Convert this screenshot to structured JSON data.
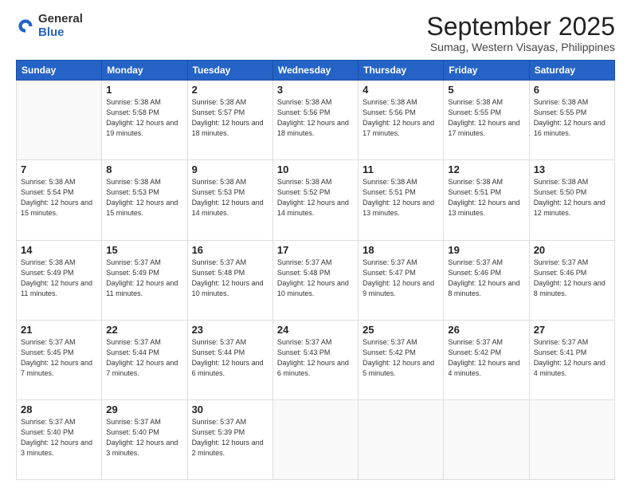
{
  "logo": {
    "general": "General",
    "blue": "Blue"
  },
  "header": {
    "month": "September 2025",
    "location": "Sumag, Western Visayas, Philippines"
  },
  "weekdays": [
    "Sunday",
    "Monday",
    "Tuesday",
    "Wednesday",
    "Thursday",
    "Friday",
    "Saturday"
  ],
  "weeks": [
    [
      {
        "day": "",
        "empty": true
      },
      {
        "day": "1",
        "sunrise": "5:38 AM",
        "sunset": "5:58 PM",
        "daylight": "12 hours and 19 minutes."
      },
      {
        "day": "2",
        "sunrise": "5:38 AM",
        "sunset": "5:57 PM",
        "daylight": "12 hours and 18 minutes."
      },
      {
        "day": "3",
        "sunrise": "5:38 AM",
        "sunset": "5:56 PM",
        "daylight": "12 hours and 18 minutes."
      },
      {
        "day": "4",
        "sunrise": "5:38 AM",
        "sunset": "5:56 PM",
        "daylight": "12 hours and 17 minutes."
      },
      {
        "day": "5",
        "sunrise": "5:38 AM",
        "sunset": "5:55 PM",
        "daylight": "12 hours and 17 minutes."
      },
      {
        "day": "6",
        "sunrise": "5:38 AM",
        "sunset": "5:55 PM",
        "daylight": "12 hours and 16 minutes."
      }
    ],
    [
      {
        "day": "7",
        "sunrise": "5:38 AM",
        "sunset": "5:54 PM",
        "daylight": "12 hours and 15 minutes."
      },
      {
        "day": "8",
        "sunrise": "5:38 AM",
        "sunset": "5:53 PM",
        "daylight": "12 hours and 15 minutes."
      },
      {
        "day": "9",
        "sunrise": "5:38 AM",
        "sunset": "5:53 PM",
        "daylight": "12 hours and 14 minutes."
      },
      {
        "day": "10",
        "sunrise": "5:38 AM",
        "sunset": "5:52 PM",
        "daylight": "12 hours and 14 minutes."
      },
      {
        "day": "11",
        "sunrise": "5:38 AM",
        "sunset": "5:51 PM",
        "daylight": "12 hours and 13 minutes."
      },
      {
        "day": "12",
        "sunrise": "5:38 AM",
        "sunset": "5:51 PM",
        "daylight": "12 hours and 13 minutes."
      },
      {
        "day": "13",
        "sunrise": "5:38 AM",
        "sunset": "5:50 PM",
        "daylight": "12 hours and 12 minutes."
      }
    ],
    [
      {
        "day": "14",
        "sunrise": "5:38 AM",
        "sunset": "5:49 PM",
        "daylight": "12 hours and 11 minutes."
      },
      {
        "day": "15",
        "sunrise": "5:37 AM",
        "sunset": "5:49 PM",
        "daylight": "12 hours and 11 minutes."
      },
      {
        "day": "16",
        "sunrise": "5:37 AM",
        "sunset": "5:48 PM",
        "daylight": "12 hours and 10 minutes."
      },
      {
        "day": "17",
        "sunrise": "5:37 AM",
        "sunset": "5:48 PM",
        "daylight": "12 hours and 10 minutes."
      },
      {
        "day": "18",
        "sunrise": "5:37 AM",
        "sunset": "5:47 PM",
        "daylight": "12 hours and 9 minutes."
      },
      {
        "day": "19",
        "sunrise": "5:37 AM",
        "sunset": "5:46 PM",
        "daylight": "12 hours and 8 minutes."
      },
      {
        "day": "20",
        "sunrise": "5:37 AM",
        "sunset": "5:46 PM",
        "daylight": "12 hours and 8 minutes."
      }
    ],
    [
      {
        "day": "21",
        "sunrise": "5:37 AM",
        "sunset": "5:45 PM",
        "daylight": "12 hours and 7 minutes."
      },
      {
        "day": "22",
        "sunrise": "5:37 AM",
        "sunset": "5:44 PM",
        "daylight": "12 hours and 7 minutes."
      },
      {
        "day": "23",
        "sunrise": "5:37 AM",
        "sunset": "5:44 PM",
        "daylight": "12 hours and 6 minutes."
      },
      {
        "day": "24",
        "sunrise": "5:37 AM",
        "sunset": "5:43 PM",
        "daylight": "12 hours and 6 minutes."
      },
      {
        "day": "25",
        "sunrise": "5:37 AM",
        "sunset": "5:42 PM",
        "daylight": "12 hours and 5 minutes."
      },
      {
        "day": "26",
        "sunrise": "5:37 AM",
        "sunset": "5:42 PM",
        "daylight": "12 hours and 4 minutes."
      },
      {
        "day": "27",
        "sunrise": "5:37 AM",
        "sunset": "5:41 PM",
        "daylight": "12 hours and 4 minutes."
      }
    ],
    [
      {
        "day": "28",
        "sunrise": "5:37 AM",
        "sunset": "5:40 PM",
        "daylight": "12 hours and 3 minutes."
      },
      {
        "day": "29",
        "sunrise": "5:37 AM",
        "sunset": "5:40 PM",
        "daylight": "12 hours and 3 minutes."
      },
      {
        "day": "30",
        "sunrise": "5:37 AM",
        "sunset": "5:39 PM",
        "daylight": "12 hours and 2 minutes."
      },
      {
        "day": "",
        "empty": true
      },
      {
        "day": "",
        "empty": true
      },
      {
        "day": "",
        "empty": true
      },
      {
        "day": "",
        "empty": true
      }
    ]
  ]
}
